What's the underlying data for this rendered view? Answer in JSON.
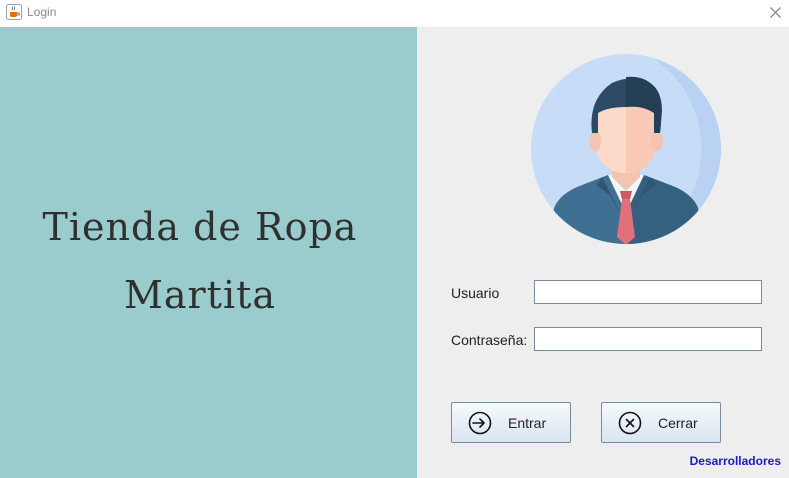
{
  "window": {
    "title": "Login",
    "app_icon": "java-cup-icon",
    "close_icon": "close-icon"
  },
  "brand": {
    "line1": "Tienda de Ropa",
    "line2": "Martita"
  },
  "form": {
    "avatar_icon": "user-avatar-icon",
    "username_label": "Usuario",
    "username_value": "",
    "password_label": "Contraseña:",
    "password_value": ""
  },
  "buttons": {
    "enter_label": "Entrar",
    "enter_icon": "login-arrow-icon",
    "close_label": "Cerrar",
    "close_icon": "close-circle-icon"
  },
  "footer": {
    "developers_link": "Desarrolladores"
  },
  "colors": {
    "left_panel_bg": "#9bcccd",
    "right_panel_bg": "#eeeeee",
    "link": "#1a1ac8",
    "avatar_bg": "#c7ddf7",
    "suit": "#3f6f93",
    "tie": "#e0707c"
  }
}
